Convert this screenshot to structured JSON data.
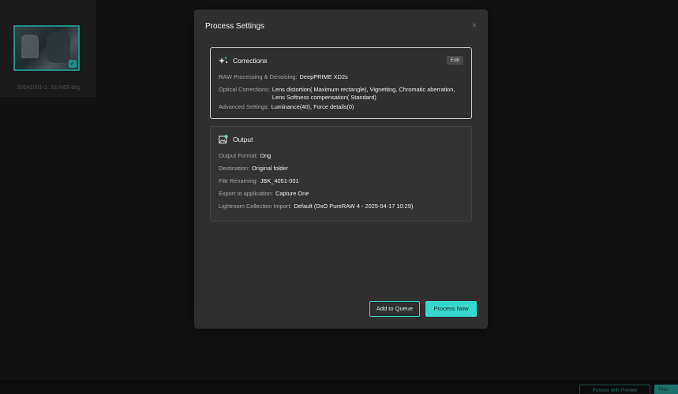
{
  "background": {
    "thumbnail_label": "20241001-J...51-NEF.dng",
    "process_with_preview_label": "Process with Preview",
    "partial_button_label": "Proc"
  },
  "modal": {
    "title": "Process Settings",
    "close_symbol": "×",
    "corrections": {
      "icon": "sparkle-icon",
      "title": "Corrections",
      "edit_label": "Edit",
      "rows": [
        {
          "label": "RAW Processing & Denoising:",
          "value": "DeepPRIME XD2s"
        },
        {
          "label": "Optical Corrections:",
          "value": "Lens distortion( Maximum rectangle), Vignetting, Chromatic aberration, Lens Softness compensation( Standard)"
        },
        {
          "label": "Advanced Settings:",
          "value": "Luminance(40), Force details(0)"
        }
      ]
    },
    "output": {
      "icon": "image-export-icon",
      "title": "Output",
      "rows": [
        {
          "label": "Output Format:",
          "value": "Dng"
        },
        {
          "label": "Destination:",
          "value": "Original folder"
        },
        {
          "label": "File Renaming:",
          "value": "JBK_4051-001"
        },
        {
          "label": "Export to application:",
          "value": "Capture One"
        },
        {
          "label": "Lightroom Collection Import:",
          "value": "Default (DxO PureRAW 4 - 2025-04-17 10:29)"
        }
      ]
    },
    "buttons": {
      "add_to_queue": "Add to Queue",
      "process_now": "Process Now"
    }
  },
  "colors": {
    "accent": "#38d9cd",
    "modal_bg": "#2f2f2f",
    "page_bg": "#121212"
  }
}
